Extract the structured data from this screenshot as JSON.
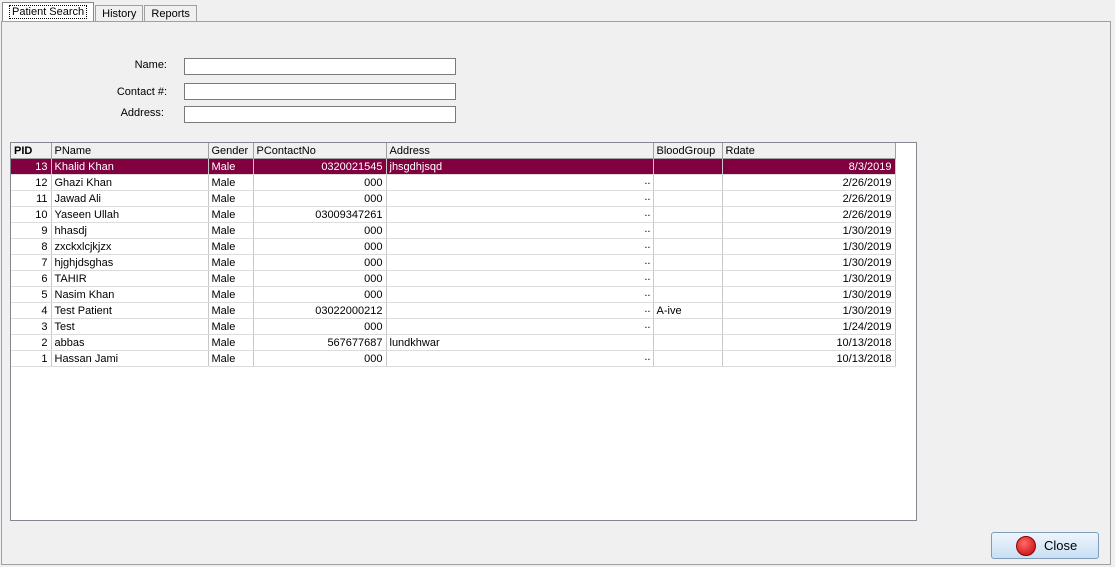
{
  "tabs": [
    "Patient Search",
    "History",
    "Reports"
  ],
  "form": {
    "name_label": "Name:",
    "contact_label": "Contact #:",
    "address_label": "Address:",
    "name_value": "",
    "contact_value": "",
    "address_value": ""
  },
  "grid": {
    "columns": [
      "PID",
      "PName",
      "Gender",
      "PContactNo",
      "Address",
      "BloodGroup",
      "Rdate"
    ],
    "rows": [
      {
        "pid": "13",
        "name": "Khalid Khan",
        "gender": "Male",
        "contact": "0320021545",
        "address": "jhsgdhjsqd",
        "address_more": "",
        "blood": "",
        "rdate": "8/3/2019"
      },
      {
        "pid": "12",
        "name": "Ghazi Khan",
        "gender": "Male",
        "contact": "000",
        "address": "",
        "address_more": "..",
        "blood": "",
        "rdate": "2/26/2019"
      },
      {
        "pid": "11",
        "name": "Jawad Ali",
        "gender": "Male",
        "contact": "000",
        "address": "",
        "address_more": "..",
        "blood": "",
        "rdate": "2/26/2019"
      },
      {
        "pid": "10",
        "name": "Yaseen Ullah",
        "gender": "Male",
        "contact": "03009347261",
        "address": "",
        "address_more": "..",
        "blood": "",
        "rdate": "2/26/2019"
      },
      {
        "pid": "9",
        "name": "hhasdj",
        "gender": "Male",
        "contact": "000",
        "address": "",
        "address_more": "..",
        "blood": "",
        "rdate": "1/30/2019"
      },
      {
        "pid": "8",
        "name": "zxckxlcjkjzx",
        "gender": "Male",
        "contact": "000",
        "address": "",
        "address_more": "..",
        "blood": "",
        "rdate": "1/30/2019"
      },
      {
        "pid": "7",
        "name": "hjghjdsghas",
        "gender": "Male",
        "contact": "000",
        "address": "",
        "address_more": "..",
        "blood": "",
        "rdate": "1/30/2019"
      },
      {
        "pid": "6",
        "name": "TAHIR",
        "gender": "Male",
        "contact": "000",
        "address": "",
        "address_more": "..",
        "blood": "",
        "rdate": "1/30/2019"
      },
      {
        "pid": "5",
        "name": "Nasim Khan",
        "gender": "Male",
        "contact": "000",
        "address": "",
        "address_more": "..",
        "blood": "",
        "rdate": "1/30/2019"
      },
      {
        "pid": "4",
        "name": "Test Patient",
        "gender": "Male",
        "contact": "03022000212",
        "address": "",
        "address_more": "..",
        "blood": "A-ive",
        "rdate": "1/30/2019"
      },
      {
        "pid": "3",
        "name": "Test",
        "gender": "Male",
        "contact": "000",
        "address": "",
        "address_more": "..",
        "blood": "",
        "rdate": "1/24/2019"
      },
      {
        "pid": "2",
        "name": "abbas",
        "gender": "Male",
        "contact": "567677687",
        "address": "lundkhwar",
        "address_more": "",
        "blood": "",
        "rdate": "10/13/2018"
      },
      {
        "pid": "1",
        "name": "Hassan Jami",
        "gender": "Male",
        "contact": "000",
        "address": "",
        "address_more": "..",
        "blood": "",
        "rdate": "10/13/2018"
      }
    ],
    "selected_row_index": 0,
    "selected_color": "#800040"
  },
  "buttons": {
    "close_label": "Close",
    "close_icon": "power-icon"
  }
}
